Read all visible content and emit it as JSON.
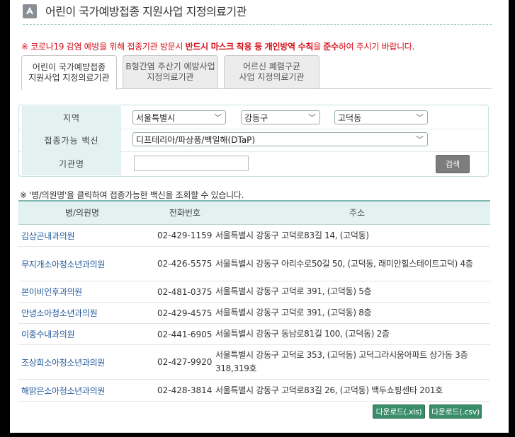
{
  "title": "어린이 국가예방접종 지원사업 지정의료기관",
  "notice": {
    "prefix": "※ 코로나19 감염 예방을 위해 접종기관 방문시 ",
    "bold1": "반드시 마스크 착용 등 개인방역 수칙",
    "mid": "을 ",
    "bold2": "준수",
    "suffix": "하여 주시기 바랍니다."
  },
  "tabs": [
    {
      "line1": "어린이 국가예방접종",
      "line2": "지원사업 지정의료기관",
      "active": true
    },
    {
      "line1": "B형간염 주산기 예방사업",
      "line2": "지정의료기관",
      "active": false
    },
    {
      "line1": "어르신 폐렴구균",
      "line2": "사업 지정의료기관",
      "active": false
    }
  ],
  "search": {
    "region_label": "지역",
    "region1": "서울특별시",
    "region2": "강동구",
    "region3": "고덕동",
    "vaccine_label": "접종가능 백신",
    "vaccine": "디프테리아/파상풍/백일해(DTaP)",
    "org_label": "기관명",
    "org_value": "",
    "search_button": "검색"
  },
  "hint": "※ '병/의원명'을 클릭하여 접종가능한 백신을 조회할 수 있습니다.",
  "table": {
    "headers": [
      "병/의원명",
      "전화번호",
      "주소"
    ],
    "rows": [
      {
        "name": "김상곤내과의원",
        "phone": "02-429-1159",
        "address": "서울특별시 강동구 고덕로83길 14, (고덕동)"
      },
      {
        "name": "무지개소아청소년과의원",
        "phone": "02-426-5575",
        "address": "서울특별시 강동구 아리수로50길 50, (고덕동, 래미안힐스테이트고덕) 4층"
      },
      {
        "name": "본이비인후과의원",
        "phone": "02-481-0375",
        "address": "서울특별시 강동구 고덕로 391, (고덕동) 5층"
      },
      {
        "name": "안녕소아청소년과의원",
        "phone": "02-429-4575",
        "address": "서울특별시 강동구 고덕로 391, (고덕동) 8층"
      },
      {
        "name": "이종수내과의원",
        "phone": "02-441-6905",
        "address": "서울특별시 강동구 동남로81길 100, (고덕동) 2층"
      },
      {
        "name": "조상희소아청소년과의원",
        "phone": "02-427-9920",
        "address": "서울특별시 강동구 고덕로 353, (고덕동) 고덕그라시움아파트 상가동 3층 318,319호"
      },
      {
        "name": "해맑은소아청소년과의원",
        "phone": "02-428-3814",
        "address": "서울특별시 강동구 고덕로83길 26, (고덕동) 백두쇼핑센타 201호"
      }
    ]
  },
  "downloads": {
    "xls": "다운로드(.xls)",
    "csv": "다운로드(.csv)"
  }
}
